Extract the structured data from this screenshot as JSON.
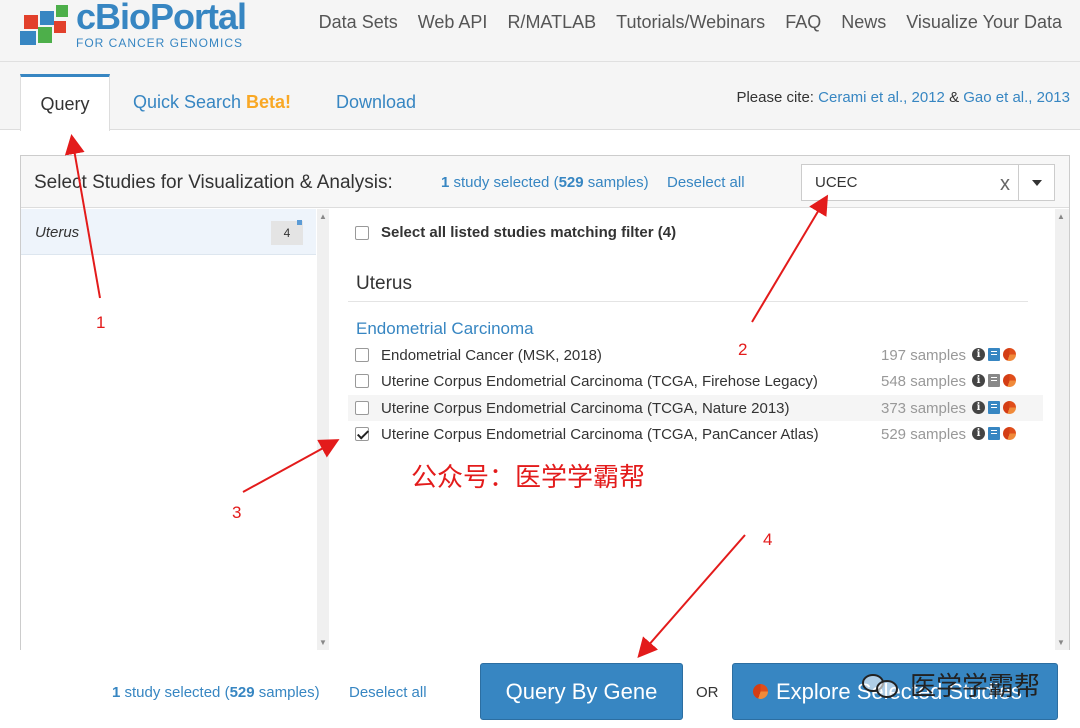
{
  "header": {
    "logo_name": "cBioPortal",
    "logo_sub": "FOR CANCER GENOMICS",
    "nav": [
      "Data Sets",
      "Web API",
      "R/MATLAB",
      "Tutorials/Webinars",
      "FAQ",
      "News",
      "Visualize Your Data"
    ]
  },
  "tabs": {
    "query": "Query",
    "quick_search": "Quick Search",
    "beta": "Beta!",
    "download": "Download"
  },
  "cite": {
    "prefix": "Please cite:",
    "ref1": "Cerami et al., 2012",
    "amp": "&",
    "ref2": "Gao et al., 2013"
  },
  "panel": {
    "title": "Select Studies for Visualization & Analysis:",
    "selected_count": "1",
    "selected_text_a": "study selected (",
    "selected_samples": "529",
    "selected_text_b": "samples)",
    "deselect_all": "Deselect all",
    "search_value": "UCEC",
    "search_clear": "x"
  },
  "left_list": {
    "items": [
      {
        "label": "Uterus",
        "count": "4"
      }
    ]
  },
  "right_list": {
    "select_all_label": "Select all listed studies matching filter (4)",
    "group_title": "Uterus",
    "subgroup_title": "Endometrial Carcinoma",
    "studies": [
      {
        "name": "Endometrial Cancer (MSK, 2018)",
        "samples": "197 samples",
        "checked": false
      },
      {
        "name": "Uterine Corpus Endometrial Carcinoma (TCGA, Firehose Legacy)",
        "samples": "548 samples",
        "checked": false
      },
      {
        "name": "Uterine Corpus Endometrial Carcinoma (TCGA, Nature 2013)",
        "samples": "373 samples",
        "checked": false
      },
      {
        "name": "Uterine Corpus Endometrial Carcinoma (TCGA, PanCancer Atlas)",
        "samples": "529 samples",
        "checked": true
      }
    ]
  },
  "watermark_text": "公众号：医学学霸帮",
  "bottom": {
    "selected_count": "1",
    "selected_text_a": "study selected (",
    "selected_samples": "529",
    "selected_text_b": "samples)",
    "deselect_all": "Deselect all",
    "query_button": "Query By Gene",
    "or": "OR",
    "explore_button": "Explore Selected Studies"
  },
  "watermark_logo_text": "医学学霸帮",
  "annotations": [
    "1",
    "2",
    "3",
    "4"
  ],
  "colors": {
    "brand_blue": "#3786c2",
    "annotation_red": "#e31b1b",
    "beta_orange": "#f9a825"
  }
}
